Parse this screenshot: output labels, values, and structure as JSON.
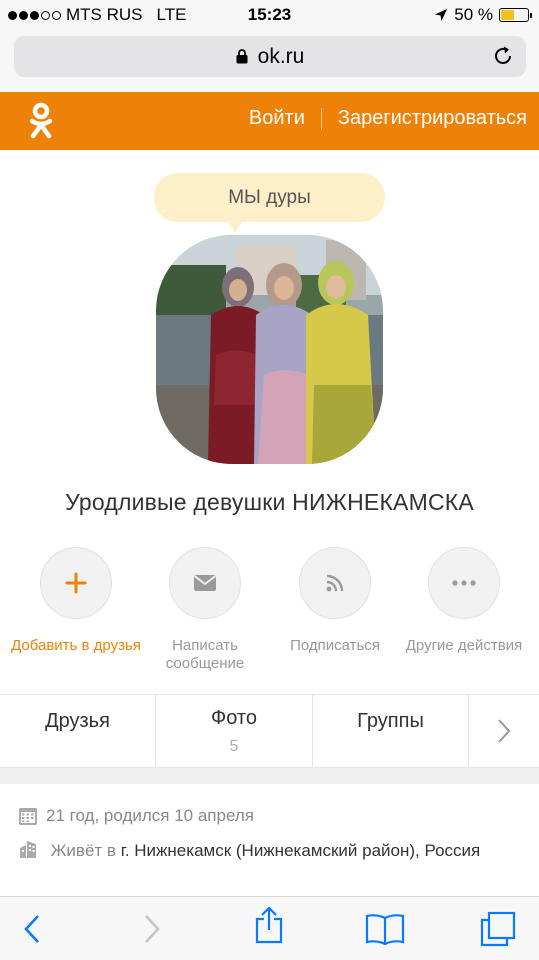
{
  "status_bar": {
    "carrier": "MTS RUS",
    "network": "LTE",
    "time": "15:23",
    "battery": "50 %",
    "battery_level": 0.5
  },
  "browser": {
    "url": "ok.ru"
  },
  "header": {
    "login": "Войти",
    "register": "Зарегистрироваться"
  },
  "profile": {
    "status": "МЫ дуры",
    "name": "Уродливые девушки НИЖНЕКАМСКА"
  },
  "actions": [
    {
      "label": "Добавить в друзья",
      "icon": "plus-icon"
    },
    {
      "label": "Написать сообщение",
      "icon": "envelope-icon"
    },
    {
      "label": "Подписаться",
      "icon": "rss-icon"
    },
    {
      "label": "Другие действия",
      "icon": "more-dots-icon"
    }
  ],
  "tabs": [
    {
      "label": "Друзья",
      "count": ""
    },
    {
      "label": "Фото",
      "count": "5"
    },
    {
      "label": "Группы",
      "count": ""
    }
  ],
  "info": {
    "age_birthday": "21 год, родился 10 апреля",
    "lives_prefix": "Живёт в",
    "location": "г. Нижнекамск (Нижнекамский район), Россия"
  },
  "colors": {
    "brand_orange": "#ee8208",
    "status_bubble": "#fdf0c8",
    "ios_blue": "#0a7aff"
  }
}
